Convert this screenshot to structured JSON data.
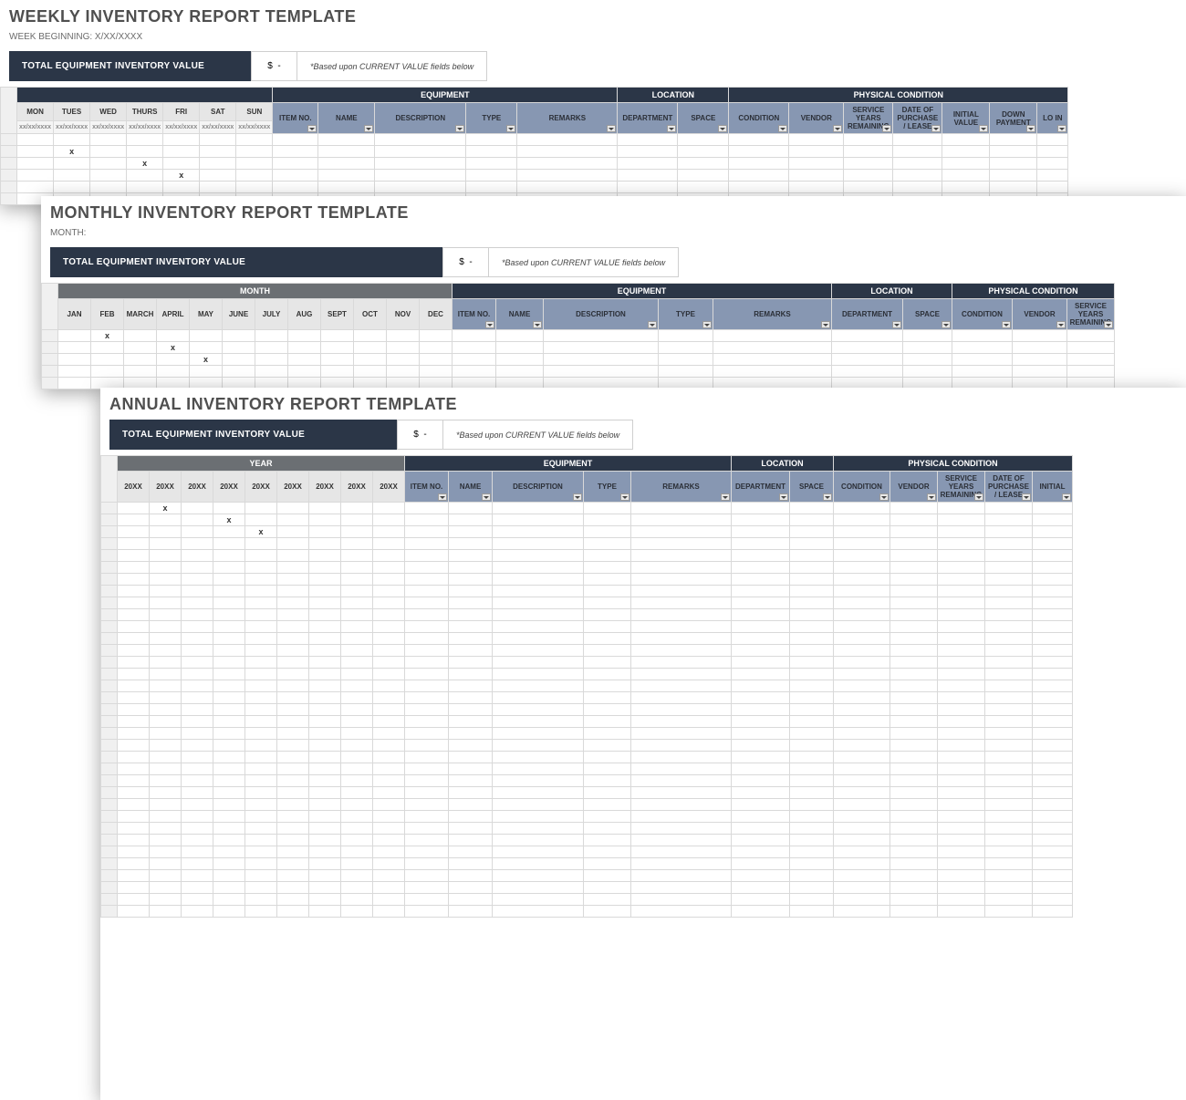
{
  "weekly": {
    "title": "WEEKLY INVENTORY REPORT TEMPLATE",
    "subtitle": "WEEK BEGINNING: X/XX/XXXX",
    "total_label": "TOTAL EQUIPMENT INVENTORY VALUE",
    "total_symbol": "$",
    "total_value": "-",
    "total_note": "*Based upon CURRENT VALUE fields below",
    "groups": {
      "equipment": "EQUIPMENT",
      "location": "LOCATION",
      "condition": "PHYSICAL CONDITION"
    },
    "days": [
      "MON",
      "TUES",
      "WED",
      "THURS",
      "FRI",
      "SAT",
      "SUN"
    ],
    "day_placeholder": "xx/xx/xxxx",
    "cols": [
      "ITEM NO.",
      "NAME",
      "DESCRIPTION",
      "TYPE",
      "REMARKS",
      "DEPARTMENT",
      "SPACE",
      "CONDITION",
      "VENDOR",
      "SERVICE YEARS REMAINING",
      "DATE OF PURCHASE / LEASE",
      "INITIAL VALUE",
      "DOWN PAYMENT",
      "LO IN"
    ],
    "marks": [
      [
        1,
        1
      ],
      [
        2,
        3
      ],
      [
        3,
        4
      ]
    ]
  },
  "monthly": {
    "title": "MONTHLY INVENTORY REPORT TEMPLATE",
    "subtitle": "MONTH:",
    "total_label": "TOTAL EQUIPMENT INVENTORY VALUE",
    "total_symbol": "$",
    "total_value": "-",
    "total_note": "*Based upon CURRENT VALUE fields below",
    "groups": {
      "month": "MONTH",
      "equipment": "EQUIPMENT",
      "location": "LOCATION",
      "condition": "PHYSICAL CONDITION"
    },
    "months": [
      "JAN",
      "FEB",
      "MARCH",
      "APRIL",
      "MAY",
      "JUNE",
      "JULY",
      "AUG",
      "SEPT",
      "OCT",
      "NOV",
      "DEC"
    ],
    "cols": [
      "ITEM NO.",
      "NAME",
      "DESCRIPTION",
      "TYPE",
      "REMARKS",
      "DEPARTMENT",
      "SPACE",
      "CONDITION",
      "VENDOR",
      "SERVICE YEARS REMAINING"
    ],
    "marks": [
      [
        0,
        1
      ],
      [
        1,
        3
      ],
      [
        2,
        4
      ]
    ]
  },
  "annual": {
    "title": "ANNUAL INVENTORY REPORT TEMPLATE",
    "total_label": "TOTAL EQUIPMENT INVENTORY VALUE",
    "total_symbol": "$",
    "total_value": "-",
    "total_note": "*Based upon CURRENT VALUE fields below",
    "groups": {
      "year": "YEAR",
      "equipment": "EQUIPMENT",
      "location": "LOCATION",
      "condition": "PHYSICAL CONDITION"
    },
    "year_placeholder": "20XX",
    "year_count": 9,
    "cols": [
      "ITEM NO.",
      "NAME",
      "DESCRIPTION",
      "TYPE",
      "REMARKS",
      "DEPARTMENT",
      "SPACE",
      "CONDITION",
      "VENDOR",
      "SERVICE YEARS REMAINING",
      "DATE OF PURCHASE / LEASE",
      "INITIAL"
    ],
    "marks": [
      [
        0,
        1
      ],
      [
        1,
        3
      ],
      [
        2,
        4
      ]
    ]
  },
  "x_mark": "x"
}
